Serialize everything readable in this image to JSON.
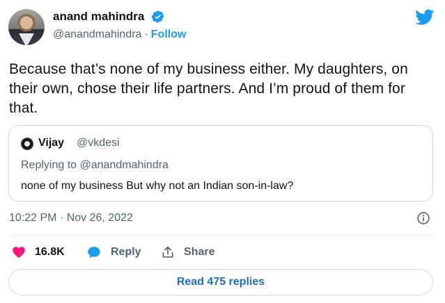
{
  "author": {
    "name": "anand mahindra",
    "handle": "@anandmahindra",
    "separator": "·",
    "follow_label": "Follow",
    "verified": true
  },
  "tweet": {
    "text": "Because that’s none of my business either. My daughters, on their own, chose their life partners. And I’m proud of them for that."
  },
  "quoted_tweet": {
    "name": "Vijay",
    "handle": "@vkdesi",
    "replying_to_label": "Replying to",
    "replying_to_handle": "@anandmahindra",
    "text": "none of my business But why not an Indian son-in-law?"
  },
  "timestamp": "10:22 PM · Nov 26, 2022",
  "actions": {
    "like_count": "16.8K",
    "reply_label": "Reply",
    "share_label": "Share"
  },
  "read_replies_label": "Read 475 replies",
  "icons": {
    "verified": "verified-badge-icon",
    "brand": "twitter-bird-icon",
    "info": "info-icon",
    "like": "heart-icon",
    "reply": "speech-bubble-icon",
    "share": "share-upload-icon"
  },
  "colors": {
    "accent": "#1d9bf0",
    "like": "#f91880",
    "muted_text": "#536471",
    "border": "#cfd9de"
  }
}
